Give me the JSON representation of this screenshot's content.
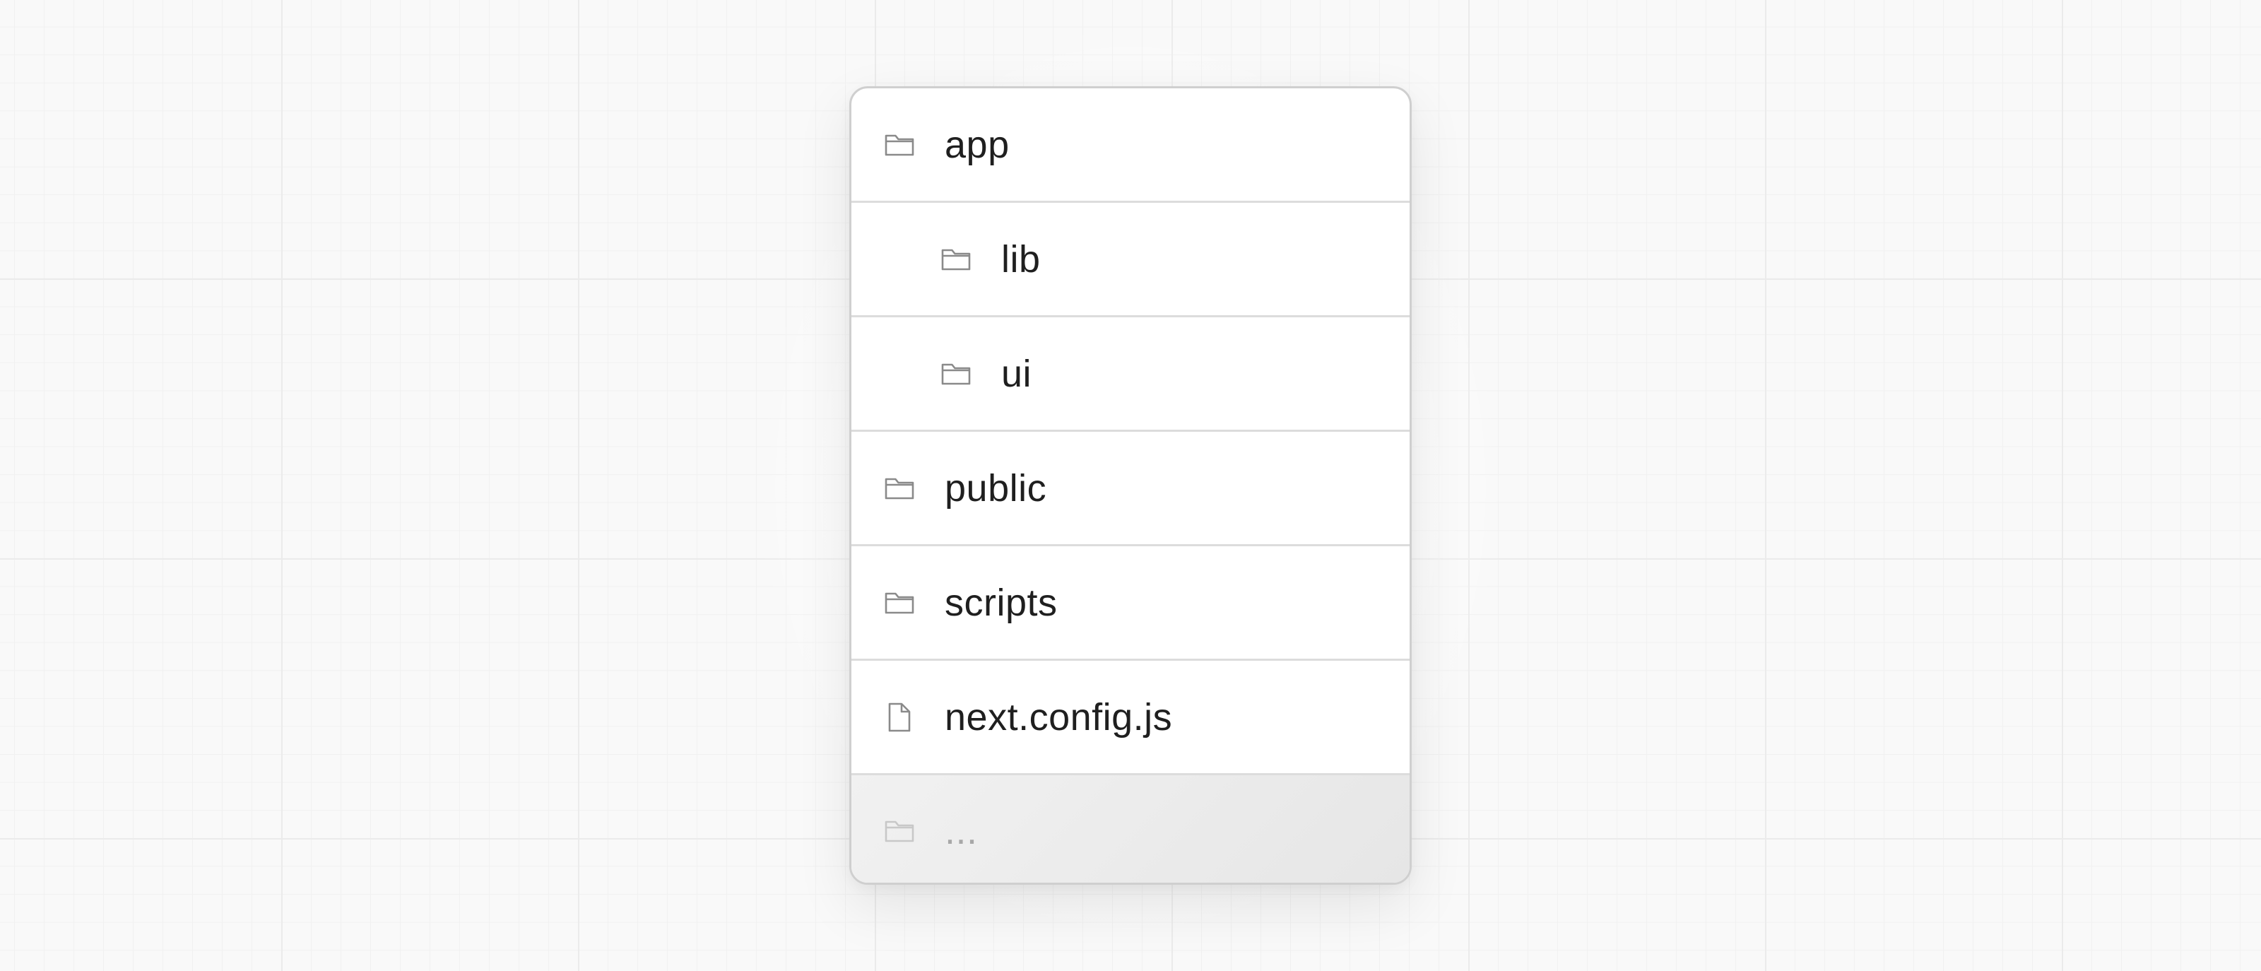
{
  "tree": {
    "items": [
      {
        "label": "app",
        "icon": "folder-icon",
        "depth": 0
      },
      {
        "label": "lib",
        "icon": "folder-icon",
        "depth": 1
      },
      {
        "label": "ui",
        "icon": "folder-icon",
        "depth": 1
      },
      {
        "label": "public",
        "icon": "folder-icon",
        "depth": 0
      },
      {
        "label": "scripts",
        "icon": "folder-icon",
        "depth": 0
      },
      {
        "label": "next.config.js",
        "icon": "file-icon",
        "depth": 0
      },
      {
        "label": "...",
        "icon": "folder-icon",
        "depth": 0,
        "muted": true
      }
    ]
  },
  "colors": {
    "icon_stroke": "#8a8a8a",
    "icon_stroke_muted": "#c8c8c8",
    "text": "#1f1f1f",
    "text_muted": "#a8a8a8",
    "border": "#cfcfcf"
  }
}
